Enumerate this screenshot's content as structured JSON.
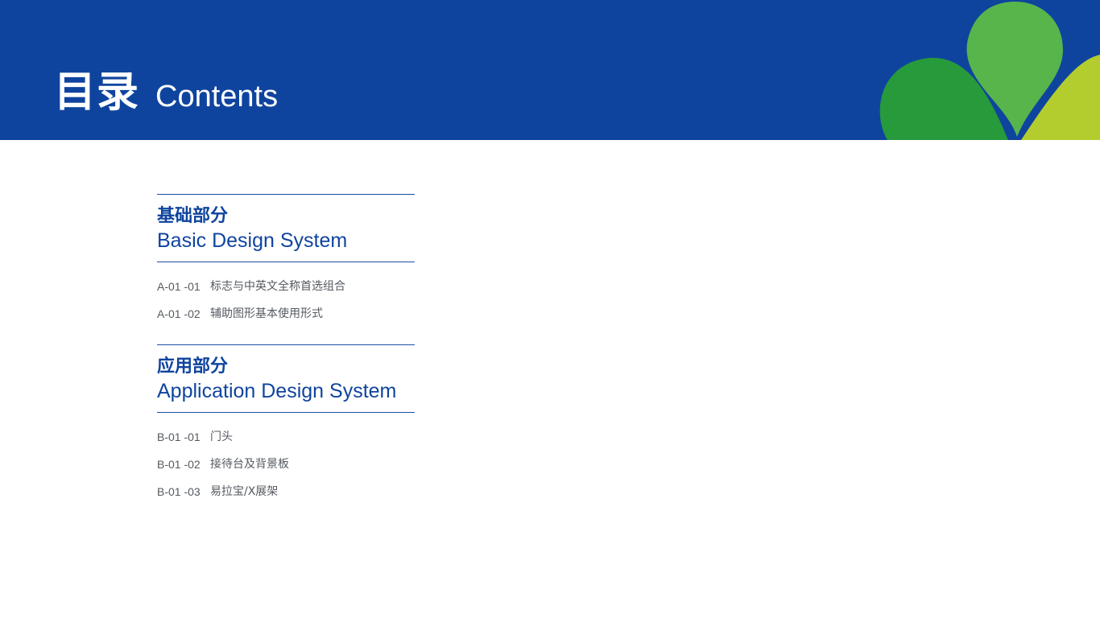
{
  "header": {
    "title_zh": "目录",
    "title_en": "Contents",
    "background_color": "#0f449e",
    "decoration_colors": [
      "#279a3c",
      "#57b54b",
      "#b3cd2e"
    ]
  },
  "sections": [
    {
      "title_zh": "基础部分",
      "title_en": "Basic Design System",
      "items": [
        {
          "code": "A-01 -01",
          "text": "标志与中英文全称首选组合"
        },
        {
          "code": "A-01 -02",
          "text": "辅助图形基本使用形式"
        }
      ]
    },
    {
      "title_zh": "应用部分",
      "title_en": "Application Design System",
      "items": [
        {
          "code": "B-01 -01",
          "text": "门头"
        },
        {
          "code": "B-01 -02",
          "text": "接待台及背景板"
        },
        {
          "code": "B-01 -03",
          "text": "易拉宝/X展架"
        }
      ]
    }
  ]
}
